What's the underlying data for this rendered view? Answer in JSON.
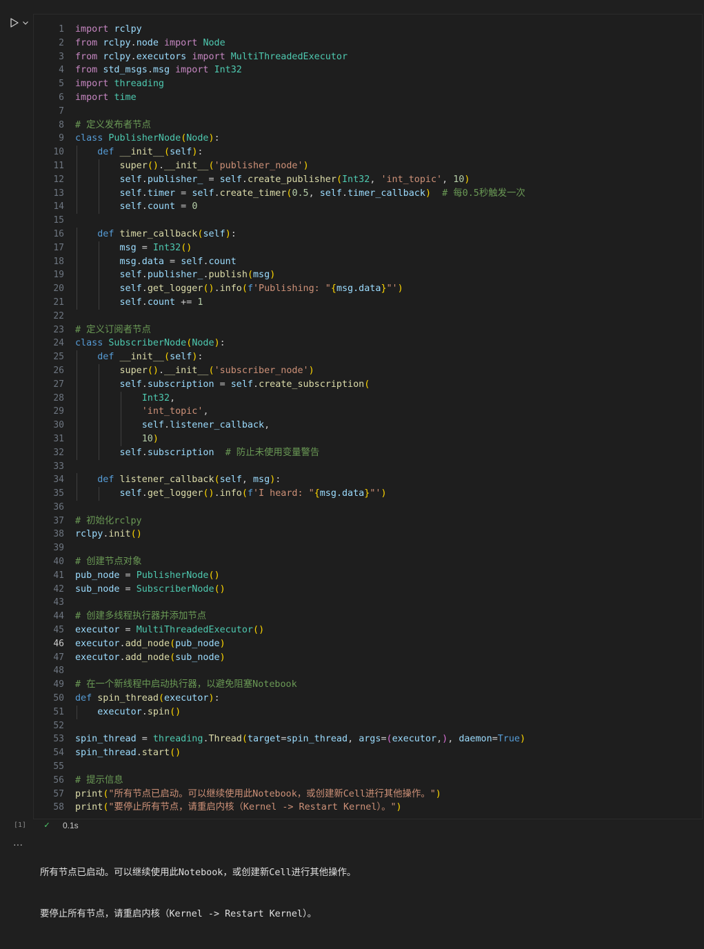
{
  "cell": {
    "execution_count": "[1]",
    "status_time": "0.1s",
    "active_line": 46,
    "lines": [
      "import rclpy",
      "from rclpy.node import Node",
      "from rclpy.executors import MultiThreadedExecutor",
      "from std_msgs.msg import Int32",
      "import threading",
      "import time",
      "",
      "# 定义发布者节点",
      "class PublisherNode(Node):",
      "    def __init__(self):",
      "        super().__init__('publisher_node')",
      "        self.publisher_ = self.create_publisher(Int32, 'int_topic', 10)",
      "        self.timer = self.create_timer(0.5, self.timer_callback)  # 每0.5秒触发一次",
      "        self.count = 0",
      "",
      "    def timer_callback(self):",
      "        msg = Int32()",
      "        msg.data = self.count",
      "        self.publisher_.publish(msg)",
      "        self.get_logger().info(f'Publishing: \"{msg.data}\"')",
      "        self.count += 1",
      "",
      "# 定义订阅者节点",
      "class SubscriberNode(Node):",
      "    def __init__(self):",
      "        super().__init__('subscriber_node')",
      "        self.subscription = self.create_subscription(",
      "            Int32,",
      "            'int_topic',",
      "            self.listener_callback,",
      "            10)",
      "        self.subscription  # 防止未使用变量警告",
      "",
      "    def listener_callback(self, msg):",
      "        self.get_logger().info(f'I heard: \"{msg.data}\"')",
      "",
      "# 初始化rclpy",
      "rclpy.init()",
      "",
      "# 创建节点对象",
      "pub_node = PublisherNode()",
      "sub_node = SubscriberNode()",
      "",
      "# 创建多线程执行器并添加节点",
      "executor = MultiThreadedExecutor()",
      "executor.add_node(pub_node)",
      "executor.add_node(sub_node)",
      "",
      "# 在一个新线程中启动执行器，以避免阻塞Notebook",
      "def spin_thread(executor):",
      "    executor.spin()",
      "",
      "spin_thread = threading.Thread(target=spin_thread, args=(executor,), daemon=True)",
      "spin_thread.start()",
      "",
      "# 提示信息",
      "print(\"所有节点已启动。可以继续使用此Notebook，或创建新Cell进行其他操作。\")",
      "print(\"要停止所有节点，请重启内核（Kernel -> Restart Kernel）。\")"
    ]
  },
  "output": {
    "lines": [
      "所有节点已启动。可以继续使用此Notebook，或创建新Cell进行其他操作。",
      "要停止所有节点，请重启内核（Kernel -> Restart Kernel）。"
    ]
  },
  "icons": {
    "run": "play-icon",
    "run_menu": "chevron-down-icon",
    "success": "check-icon",
    "more": "ellipsis-icon"
  },
  "colors": {
    "background": "#1f1f1f",
    "editor": "#1e1e1e",
    "keyword": "#c586c0",
    "string": "#ce9178",
    "comment": "#6a9955",
    "class": "#4ec9b0",
    "function": "#dcdcaa",
    "success": "#4ec96a"
  }
}
